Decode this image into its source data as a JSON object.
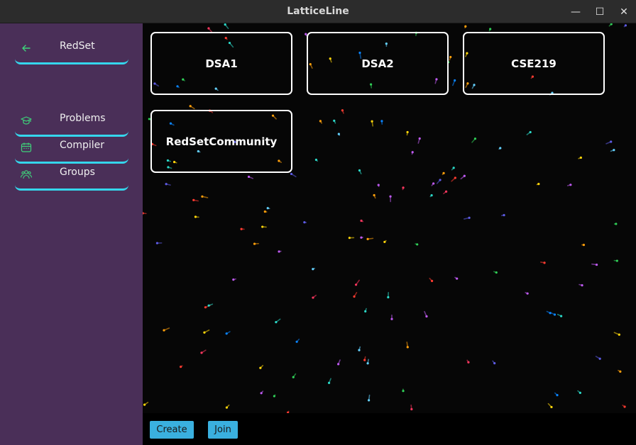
{
  "window": {
    "title": "LatticeLine",
    "minimize_glyph": "—",
    "maximize_glyph": "☐",
    "close_glyph": "✕"
  },
  "sidebar": {
    "back_item": {
      "label": "RedSet",
      "icon": "arrow-left-icon"
    },
    "items": [
      {
        "label": "Problems",
        "icon": "graduation-cap-icon"
      },
      {
        "label": "Compiler",
        "icon": "calendar-icon"
      },
      {
        "label": "Groups",
        "icon": "users-icon"
      }
    ]
  },
  "groups": [
    {
      "label": "DSA1"
    },
    {
      "label": "DSA2"
    },
    {
      "label": "CSE219"
    },
    {
      "label": "RedSetCommunity"
    }
  ],
  "footer": {
    "create_label": "Create",
    "join_label": "Join"
  },
  "colors": {
    "sidebar_bg": "#4a2f58",
    "accent_underline": "#35d6ec",
    "icon_green": "#3ed37a",
    "button_bg": "#3ab0df",
    "main_bg": "#060606"
  }
}
